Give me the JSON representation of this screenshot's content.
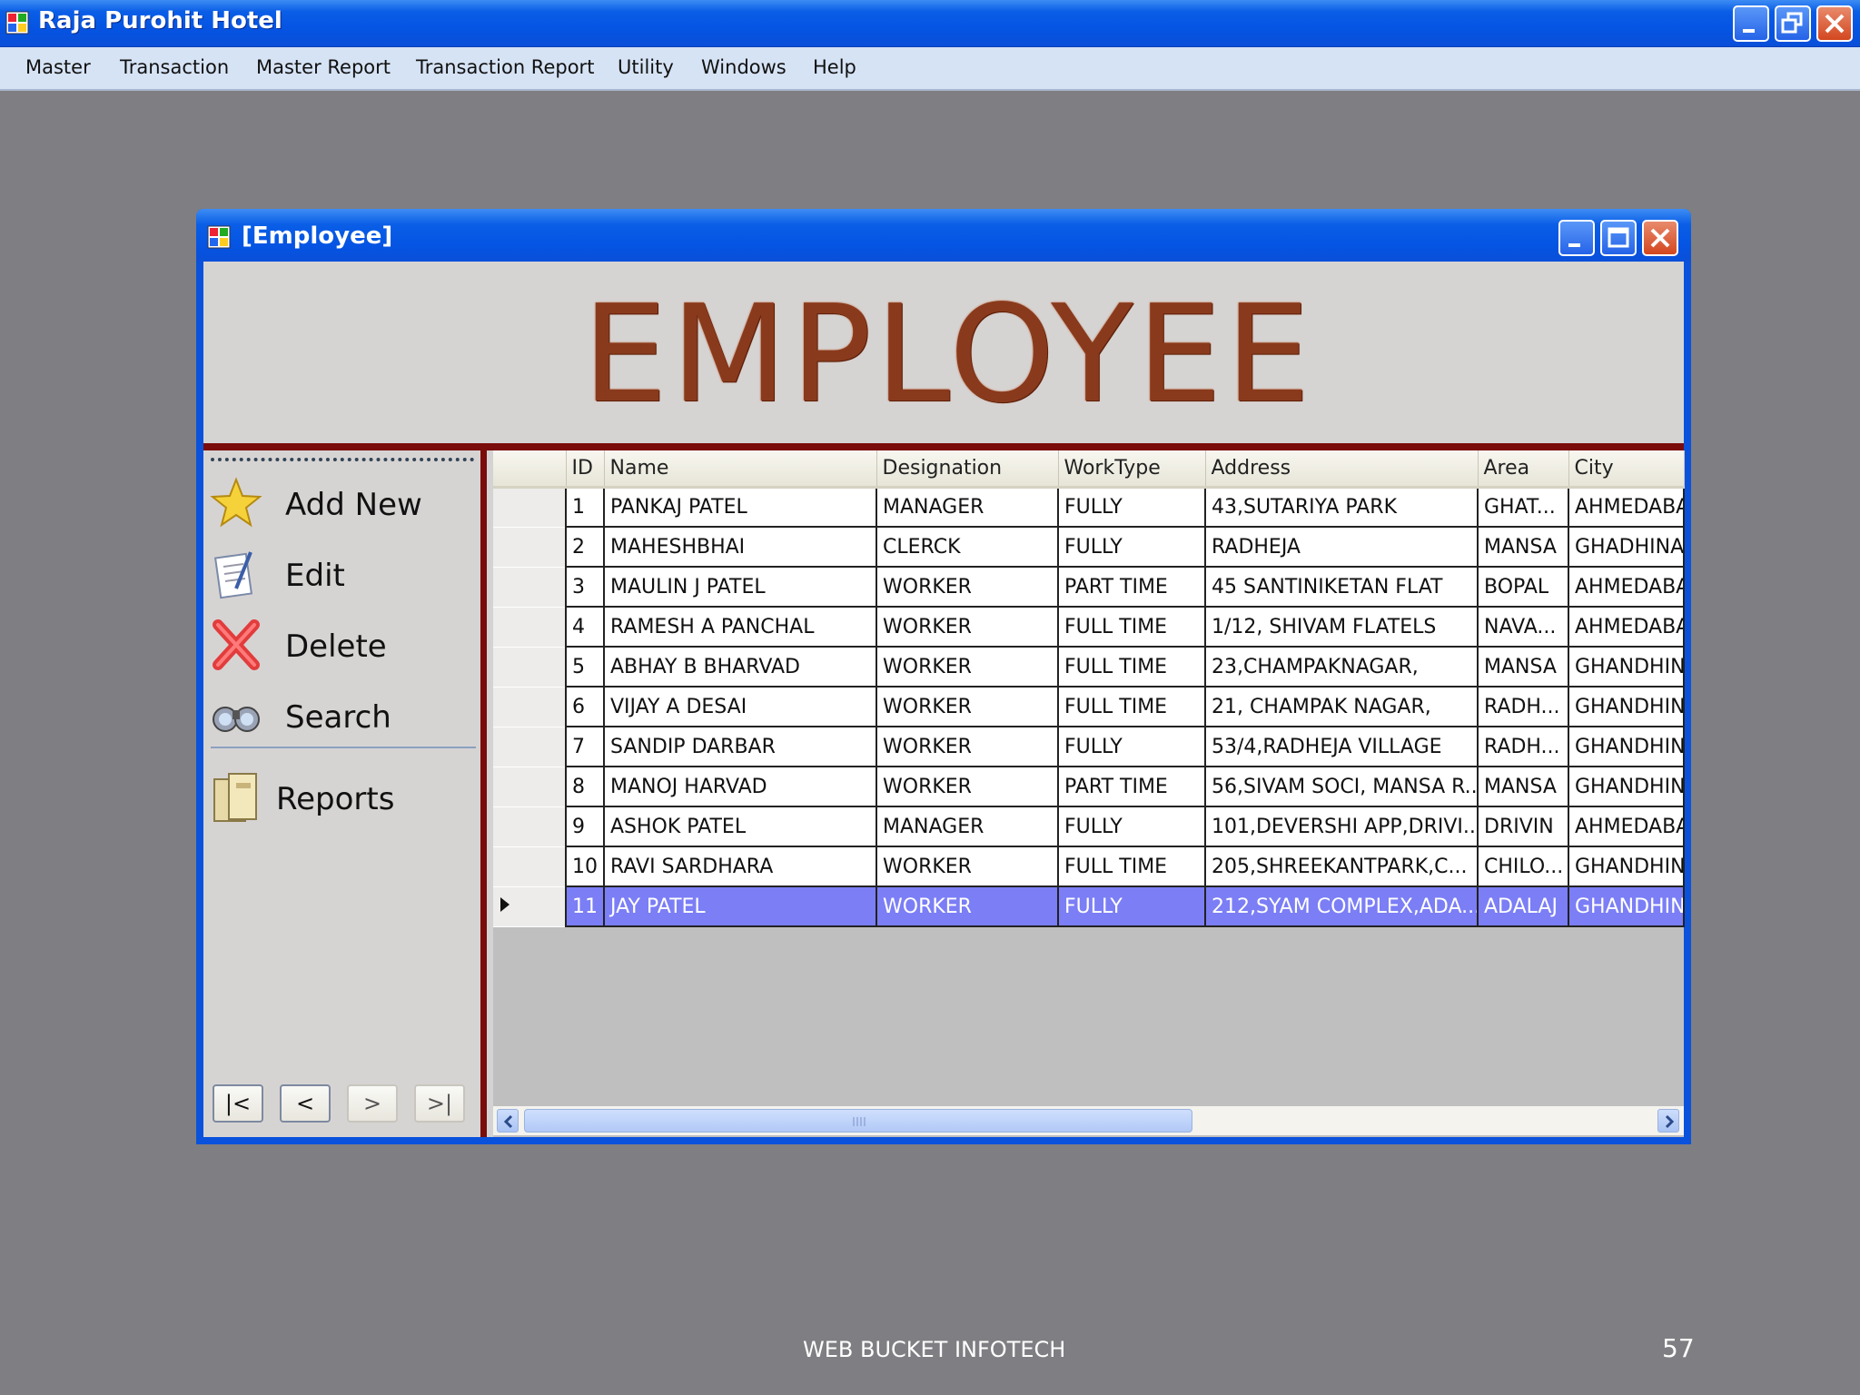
{
  "app": {
    "title": "Raja Purohit Hotel"
  },
  "menu": [
    "Master",
    "Transaction",
    "Master Report",
    "Transaction Report",
    "Utility",
    "Windows",
    "Help"
  ],
  "child_window": {
    "title": "[Employee]",
    "banner": "EMPLOYEE"
  },
  "left_panel": {
    "add_new": "Add New",
    "edit": "Edit",
    "delete": "Delete",
    "search": "Search",
    "reports": "Reports",
    "nav": {
      "first": "|<",
      "prev": "<",
      "next": ">",
      "last": ">|"
    }
  },
  "grid": {
    "columns": [
      "ID",
      "Name",
      "Designation",
      "WorkType",
      "Address",
      "Area",
      "City"
    ],
    "rows": [
      [
        "1",
        "PANKAJ PATEL",
        "MANAGER",
        "FULLY",
        "43,SUTARIYA PARK",
        "GHAT...",
        "AHMEDABA"
      ],
      [
        "2",
        "MAHESHBHAI",
        "CLERCK",
        "FULLY",
        "RADHEJA",
        "MANSA",
        "GHADHINA"
      ],
      [
        "3",
        "MAULIN J PATEL",
        "WORKER",
        "PART TIME",
        "45 SANTINIKETAN FLAT",
        "BOPAL",
        "AHMEDABA"
      ],
      [
        "4",
        "RAMESH A PANCHAL",
        "WORKER",
        "FULL TIME",
        "1/12, SHIVAM FLATELS",
        "NAVA...",
        "AHMEDABA"
      ],
      [
        "5",
        "ABHAY B BHARVAD",
        "WORKER",
        "FULL TIME",
        "23,CHAMPAKNAGAR,",
        "MANSA",
        "GHANDHIN"
      ],
      [
        "6",
        "VIJAY A DESAI",
        "WORKER",
        "FULL TIME",
        "21, CHAMPAK NAGAR,",
        "RADH...",
        "GHANDHIN"
      ],
      [
        "7",
        "SANDIP DARBAR",
        "WORKER",
        "FULLY",
        "53/4,RADHEJA VILLAGE",
        "RADH...",
        "GHANDHIN"
      ],
      [
        "8",
        "MANOJ HARVAD",
        "WORKER",
        "PART TIME",
        "56,SIVAM SOCI, MANSA R...",
        "MANSA",
        "GHANDHIN"
      ],
      [
        "9",
        "ASHOK PATEL",
        "MANAGER",
        "FULLY",
        "101,DEVERSHI APP,DRIVI...",
        "DRIVIN",
        "AHMEDABA"
      ],
      [
        "10",
        "RAVI SARDHARA",
        "WORKER",
        "FULL TIME",
        "205,SHREEKANTPARK,C...",
        "CHILO...",
        "GHANDHIN"
      ],
      [
        "11",
        "JAY PATEL",
        "WORKER",
        "FULLY",
        "212,SYAM COMPLEX,ADA...",
        "ADALAJ",
        "GHANDHIN"
      ]
    ],
    "selected_row": 10
  },
  "footer": {
    "company": "WEB BUCKET INFOTECH",
    "page": "57"
  },
  "colors": {
    "titlebar": "#0554e3",
    "banner_text": "#8a3a1c",
    "separator": "#7a0c0c",
    "selection": "#7b7ef5",
    "desktop": "#7f7e82"
  }
}
